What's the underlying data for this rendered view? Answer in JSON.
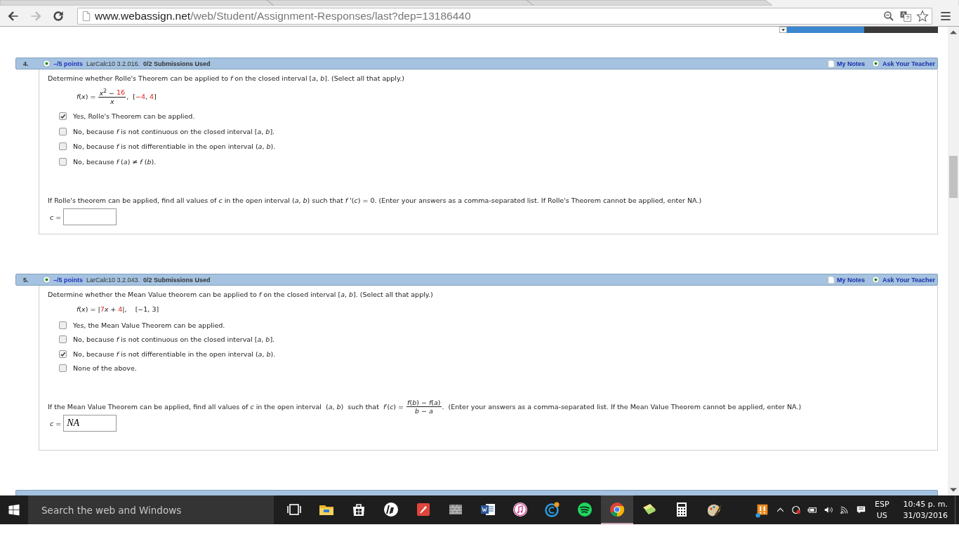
{
  "browser": {
    "address": {
      "host": "www.webassign.net",
      "path": "/web/Student/Assignment-Responses/last?dep=13186440"
    },
    "back_enabled": true,
    "forward_enabled": false
  },
  "questions": [
    {
      "number": "4.",
      "points": "–/5 points",
      "source": "LarCalc10 3.2.016.",
      "submissions": "0/2 Submissions Used",
      "links": [
        "My Notes",
        "Ask Your Teacher"
      ],
      "prompt": "Determine whether Rolle's Theorem can be applied to *f* on the closed interval [*a*, *b*]. (Select all that apply.)",
      "formula": [
        {
          "kind": "text",
          "segments": [
            {
              "text": "*f*(*x*) = ",
              "highlighted": false
            }
          ]
        },
        {
          "kind": "fraction",
          "numerator": [
            {
              "text": "*x*$^{2}$ − ",
              "highlighted": false
            },
            {
              "text": "16",
              "highlighted": true
            }
          ],
          "denominator": [
            {
              "text": "*x*",
              "highlighted": false
            }
          ]
        },
        {
          "kind": "text",
          "segments": [
            {
              "text": ",  [",
              "highlighted": false
            },
            {
              "text": "−4",
              "highlighted": true
            },
            {
              "text": ", ",
              "highlighted": false
            },
            {
              "text": "4",
              "highlighted": true
            },
            {
              "text": "]",
              "highlighted": false
            }
          ]
        }
      ],
      "options": [
        {
          "label": "Yes, Rolle's Theorem can be applied.",
          "checked": true
        },
        {
          "label": "No, because *f* is not continuous on the closed interval [*a*, *b*].",
          "checked": false
        },
        {
          "label": "No, because *f* is not differentiable in the open interval (*a*, *b*).",
          "checked": false
        },
        {
          "label": "No, because *f* (*a*) ≠ *f* (*b*).",
          "checked": false
        }
      ],
      "answer_prompt": [
        {
          "kind": "text",
          "text": "If Rolle's theorem can be applied, find all values of *c* in the open interval (*a*, *b*) such that *f* '(*c*) = 0. (Enter your answers as a comma-separated list. If Rolle's Theorem cannot be applied, enter NA.)"
        }
      ],
      "answer": {
        "label": "*c* ="
      }
    },
    {
      "number": "5.",
      "points": "–/5 points",
      "source": "LarCalc10 3.2.043.",
      "submissions": "0/2 Submissions Used",
      "links": [
        "My Notes",
        "Ask Your Teacher"
      ],
      "prompt": "Determine whether the Mean Value theorem can be applied to *f* on the closed interval  [*a*, *b*].  (Select all that apply.)",
      "formula": [
        {
          "kind": "text",
          "segments": [
            {
              "text": "*f*(*x*) = |",
              "highlighted": false
            },
            {
              "text": "7",
              "highlighted": true
            },
            {
              "text": "*x* + ",
              "highlighted": false
            },
            {
              "text": "4",
              "highlighted": true
            },
            {
              "text": "|,    [−1, 3]",
              "highlighted": false
            }
          ]
        }
      ],
      "options": [
        {
          "label": "Yes, the Mean Value Theorem can be applied.",
          "checked": false
        },
        {
          "label": "No, because *f* is not continuous on the closed interval [*a*, *b*].",
          "checked": false
        },
        {
          "label": "No, because *f* is not differentiable in the open interval (*a*, *b*).",
          "checked": true
        },
        {
          "label": "None of the above.",
          "checked": false
        }
      ],
      "answer_prompt": [
        {
          "kind": "text",
          "text": "If the Mean Value Theorem can be applied, find all values of *c* in the open interval  (*a*, *b*)  such that  *f*′(*c*) = "
        },
        {
          "kind": "fraction",
          "numerator": "*f*(*b*) − *f*(*a*)",
          "denominator": "*b* − *a*"
        },
        {
          "kind": "text",
          "text": ".  (Enter your answers as a comma-separated list. If the Mean Value Theorem cannot be applied, enter NA.)"
        }
      ],
      "answer": {
        "label": "*c* =",
        "value": "NA"
      }
    }
  ],
  "taskbar": {
    "search_placeholder": "Search the web and Windows",
    "apps": [
      {
        "kind": "task-view",
        "active": false
      },
      {
        "kind": "folder",
        "active": false
      },
      {
        "kind": "store",
        "active": false
      },
      {
        "kind": "hp",
        "active": false
      },
      {
        "kind": "red-app",
        "active": false
      },
      {
        "kind": "wall",
        "active": false
      },
      {
        "kind": "word",
        "active": false
      },
      {
        "kind": "music",
        "active": false
      },
      {
        "kind": "c-app",
        "active": false
      },
      {
        "kind": "spotify",
        "active": false
      },
      {
        "kind": "chrome",
        "active": true
      },
      {
        "kind": "notes",
        "active": false
      },
      {
        "kind": "calculator",
        "active": false
      },
      {
        "kind": "paint",
        "active": false
      }
    ],
    "language": "ESP",
    "region": "US",
    "time": "10:45 p. m.",
    "date": "31/03/2016"
  }
}
